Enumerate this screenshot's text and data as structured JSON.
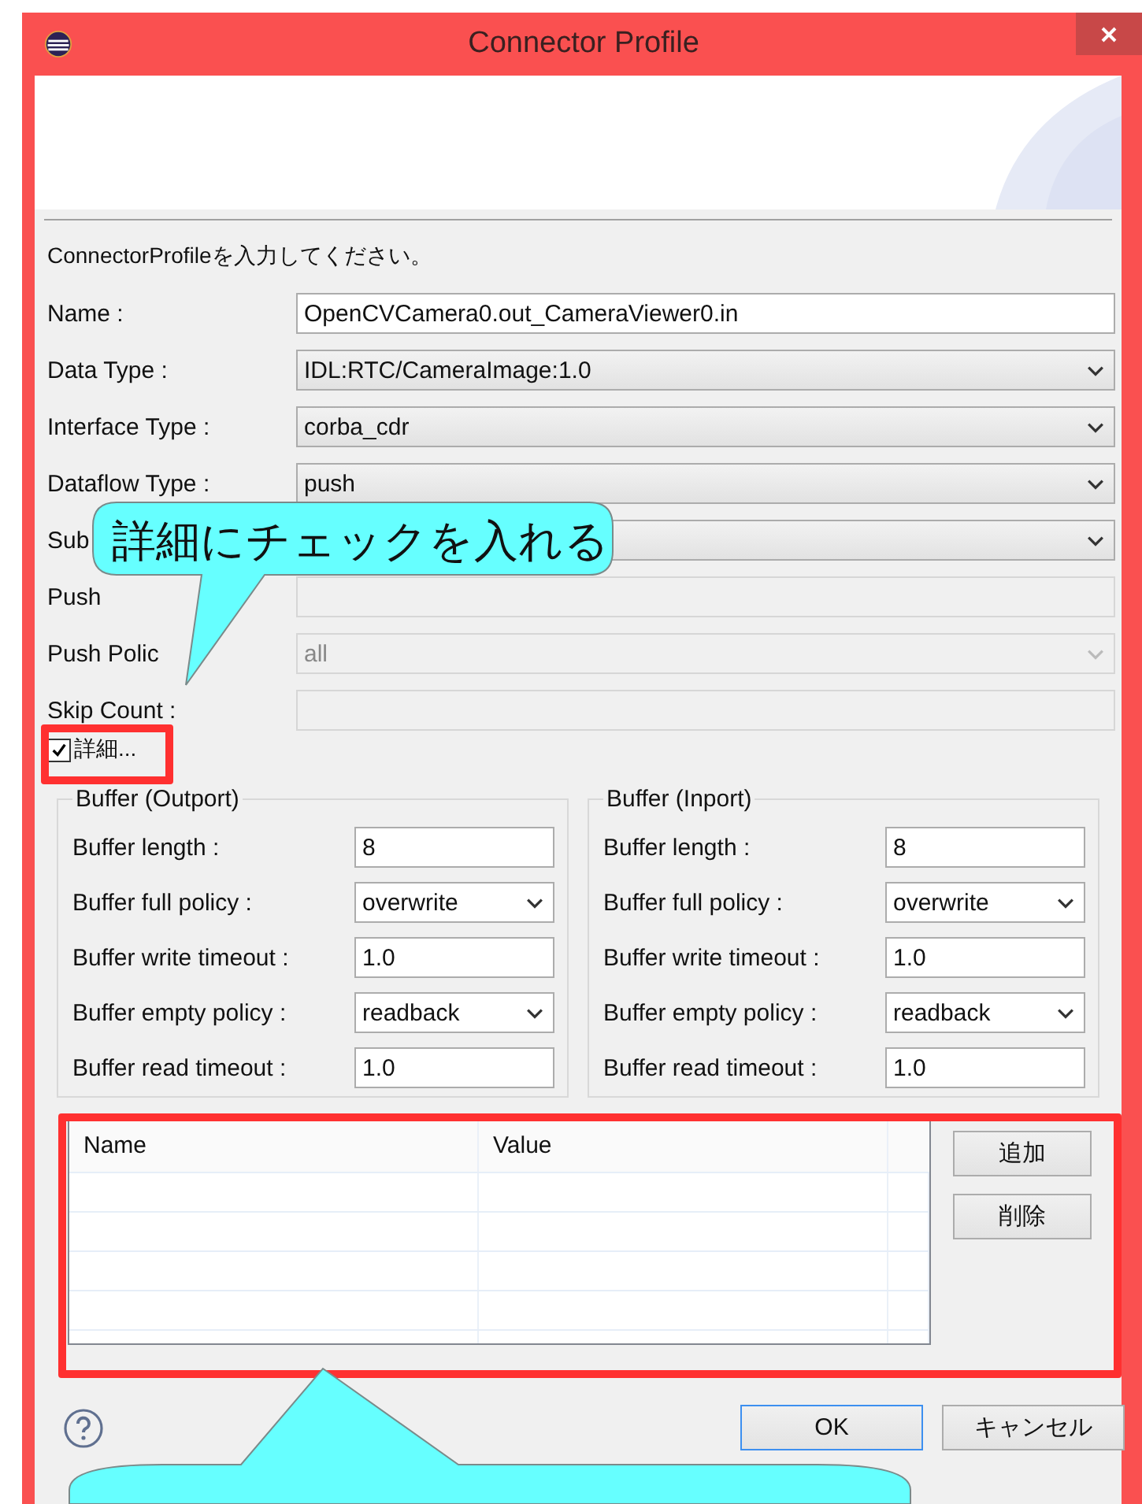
{
  "window": {
    "title": "Connector Profile"
  },
  "message": "ConnectorProfileを入力してください。",
  "fields": [
    {
      "label": "Name :",
      "kind": "text",
      "value": "OpenCVCamera0.out_CameraViewer0.in",
      "disabled": false
    },
    {
      "label": "Data Type :",
      "kind": "select",
      "value": "IDL:RTC/CameraImage:1.0",
      "disabled": false
    },
    {
      "label": "Interface Type :",
      "kind": "select",
      "value": "corba_cdr",
      "disabled": false
    },
    {
      "label": "Dataflow Type :",
      "kind": "select",
      "value": "push",
      "disabled": false
    },
    {
      "label": "Sub",
      "kind": "select",
      "disabled": false
    },
    {
      "label": "Push",
      "kind": "text",
      "disabled": true
    },
    {
      "label": "Push Polic",
      "kind": "select",
      "value": "all",
      "disabled": true
    },
    {
      "label": "Skip Count :",
      "kind": "text",
      "disabled": true
    }
  ],
  "details": {
    "label": "詳細...",
    "checked": true
  },
  "buffers": [
    {
      "title": "Buffer (Outport)",
      "rows": [
        {
          "label": "Buffer length :",
          "kind": "text",
          "value": "8"
        },
        {
          "label": "Buffer full policy :",
          "kind": "select",
          "value": "overwrite"
        },
        {
          "label": "Buffer write timeout :",
          "kind": "text",
          "value": "1.0"
        },
        {
          "label": "Buffer empty policy :",
          "kind": "select",
          "value": "readback"
        },
        {
          "label": "Buffer read timeout :",
          "kind": "text",
          "value": "1.0"
        }
      ]
    },
    {
      "title": "Buffer (Inport)",
      "rows": [
        {
          "label": "Buffer length :",
          "kind": "text",
          "value": "8"
        },
        {
          "label": "Buffer full policy :",
          "kind": "select",
          "value": "overwrite"
        },
        {
          "label": "Buffer write timeout :",
          "kind": "text",
          "value": "1.0"
        },
        {
          "label": "Buffer empty policy :",
          "kind": "select",
          "value": "readback"
        },
        {
          "label": "Buffer read timeout :",
          "kind": "text",
          "value": "1.0"
        }
      ]
    }
  ],
  "properties": {
    "columns": [
      "Name",
      "Value"
    ],
    "buttons": [
      "追加",
      "削除"
    ]
  },
  "footer_buttons": [
    {
      "label": "OK",
      "default": true
    },
    {
      "label": "キャンセル",
      "default": false
    }
  ],
  "callouts": [
    {
      "text": "詳細にチェックを入れる"
    }
  ]
}
